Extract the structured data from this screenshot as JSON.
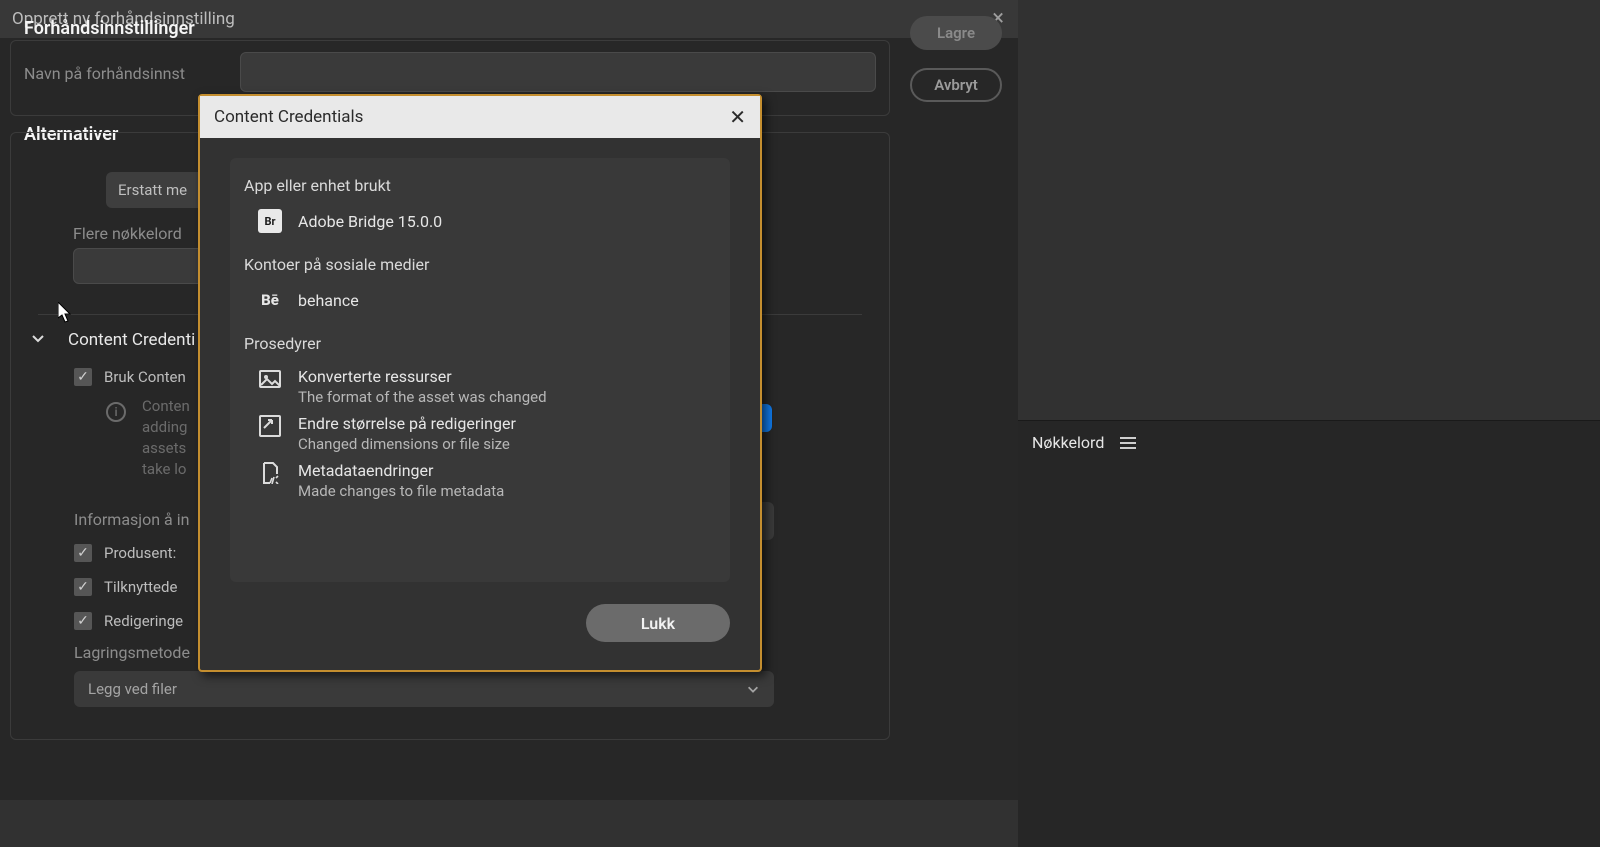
{
  "outer_dialog": {
    "title": "Opprett ny forhåndsinnstilling"
  },
  "presets": {
    "heading": "Forhåndsinnstillinger",
    "name_label": "Navn på forhåndsinnst"
  },
  "buttons": {
    "save": "Lagre",
    "cancel": "Avbryt"
  },
  "options": {
    "heading": "Alternativer",
    "replace_label": "Erstatt me",
    "more_keywords_label": "Flere nøkkelord",
    "content_credentials_label": "Content Credenti",
    "apply_cc_label": "Bruk Conten",
    "info_text": "Conten\nadding\nassets\ntake lo",
    "info_to_include_label": "Informasjon å in",
    "producer_label": "Produsent:",
    "linked_label": "Tilknyttede",
    "edits_label": "Redigeringe",
    "storage_label": "Lagringsmetode",
    "storage_value": "Legg ved filer"
  },
  "modal": {
    "title": "Content Credentials",
    "app_section": "App eller enhet brukt",
    "app_name": "Adobe Bridge 15.0.0",
    "social_section": "Kontoer på sosiale medier",
    "social_name": "behance",
    "procedures_section": "Prosedyrer",
    "procedures": [
      {
        "title": "Konverterte ressurser",
        "desc": "The format of the asset was changed"
      },
      {
        "title": "Endre størrelse på redigeringer",
        "desc": "Changed dimensions or file size"
      },
      {
        "title": "Metadataendringer",
        "desc": "Made changes to file metadata"
      }
    ],
    "close_button": "Lukk"
  },
  "right_panel": {
    "title": "Nøkkelord"
  }
}
